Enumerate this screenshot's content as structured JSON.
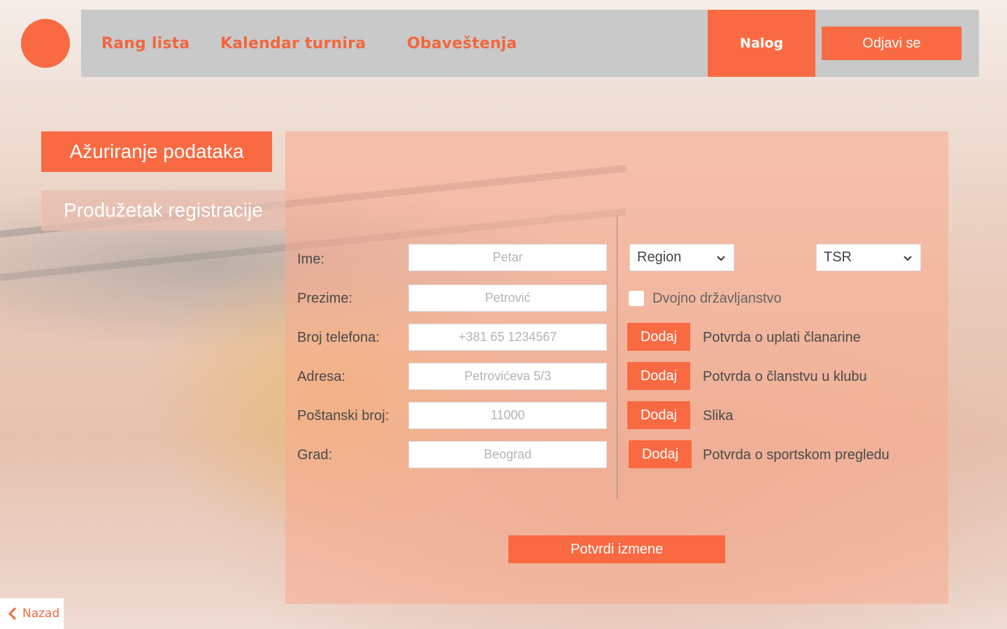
{
  "nav": {
    "links": [
      "Rang lista",
      "Kalendar turnira",
      "Obaveštenja"
    ],
    "active": "Nalog",
    "logout": "Odjavi se"
  },
  "side_tabs": {
    "active": "Ažuriranje podataka",
    "inactive": "Produžetak registracije"
  },
  "form": {
    "fields": [
      {
        "label": "Ime:",
        "placeholder": "Petar"
      },
      {
        "label": "Prezime:",
        "placeholder": "Petrović"
      },
      {
        "label": "Broj telefona:",
        "placeholder": "+381 65 1234567"
      },
      {
        "label": "Adresa:",
        "placeholder": "Petrovićeva 5/3"
      },
      {
        "label": "Poštanski broj:",
        "placeholder": "11000"
      },
      {
        "label": "Grad:",
        "placeholder": "Beograd"
      }
    ],
    "region_select": "Region",
    "federation_select": "TSR",
    "dual_citizenship": "Dvojno državljanstvo",
    "dual_citizenship_checked": false,
    "add_label": "Dodaj",
    "documents": [
      "Potvrda o uplati članarine",
      "Potvrda o članstvu u klubu",
      "Slika",
      "Potvrda o sportskom pregledu"
    ],
    "submit": "Potvrdi izmene"
  },
  "back": "Nazad",
  "colors": {
    "accent": "#f96a42",
    "nav_bg": "#c9c9c9"
  }
}
